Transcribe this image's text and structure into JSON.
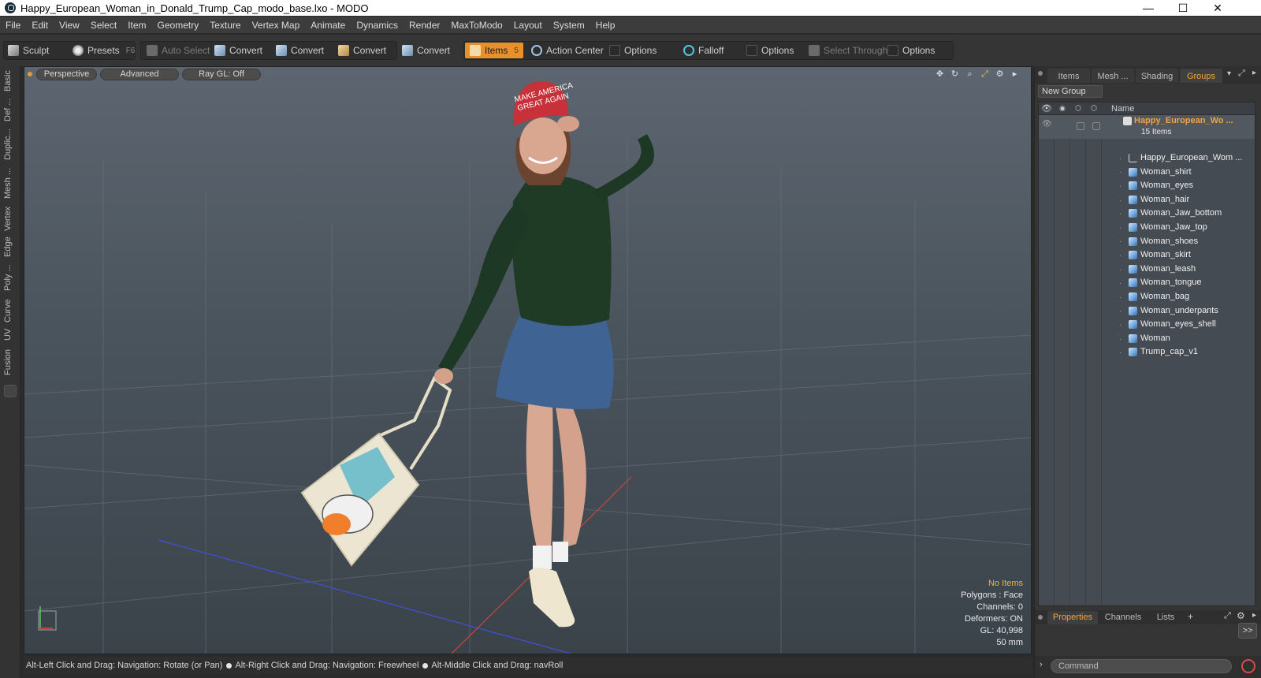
{
  "window": {
    "title": "Happy_European_Woman_in_Donald_Trump_Cap_modo_base.lxo - MODO",
    "controls": [
      "—",
      "☐",
      "✕"
    ]
  },
  "menu": [
    "File",
    "Edit",
    "View",
    "Select",
    "Item",
    "Geometry",
    "Texture",
    "Vertex Map",
    "Animate",
    "Dynamics",
    "Render",
    "MaxToModo",
    "Layout",
    "System",
    "Help"
  ],
  "toolbar": {
    "sculpt": "Sculpt",
    "presets": "Presets",
    "presets_key": "F6",
    "auto_select": "Auto Select",
    "convert1": "Convert",
    "convert2": "Convert",
    "convert3": "Convert",
    "convert4": "Convert",
    "items": "Items",
    "items_key": "5",
    "action_center": "Action Center",
    "options1": "Options",
    "falloff": "Falloff",
    "options2": "Options",
    "select_through": "Select Through",
    "options3": "Options"
  },
  "left_tabs": [
    "Basic",
    "Def ...",
    "Duplic...",
    "Mesh ...",
    "Vertex",
    "Edge",
    "Poly ...",
    "Curve",
    "UV",
    "Fusion"
  ],
  "viewport": {
    "perspective": "Perspective",
    "advanced": "Advanced",
    "raygl": "Ray GL: Off",
    "cap_text_1": "MAKE AMERICA",
    "cap_text_2": "GREAT AGAIN",
    "info": {
      "no_items": "No Items",
      "polygons": "Polygons : Face",
      "channels": "Channels: 0",
      "deformers": "Deformers: ON",
      "gl": "GL: 40,998",
      "scale": "50 mm"
    }
  },
  "status": {
    "hint1": "Alt-Left Click and Drag: Navigation: Rotate (or Pan)",
    "hint2": "Alt-Right Click and Drag: Navigation: Freewheel",
    "hint3": "Alt-Middle Click and Drag: navRoll"
  },
  "right_panel": {
    "tabs": [
      "Items",
      "Mesh ...",
      "Shading",
      "Groups"
    ],
    "active_tab": "Groups",
    "new_group": "New Group",
    "col_name": "Name",
    "group_name": "Happy_European_Wo ...",
    "group_count": "15 Items",
    "items": [
      "Happy_European_Wom ...",
      "Woman_shirt",
      "Woman_eyes",
      "Woman_hair",
      "Woman_Jaw_bottom",
      "Woman_Jaw_top",
      "Woman_shoes",
      "Woman_skirt",
      "Woman_leash",
      "Woman_tongue",
      "Woman_bag",
      "Woman_underpants",
      "Woman_eyes_shell",
      "Woman",
      "Trump_cap_v1"
    ],
    "bottom_tabs": [
      "Properties",
      "Channels",
      "Lists"
    ],
    "expand_btn": ">>",
    "command_placeholder": "Command"
  },
  "colors": {
    "accent": "#f0a340",
    "active_tool": "#e8902a",
    "sweater": "#1f3b26",
    "skirt": "#3f6494",
    "cap": "#c8303a"
  }
}
